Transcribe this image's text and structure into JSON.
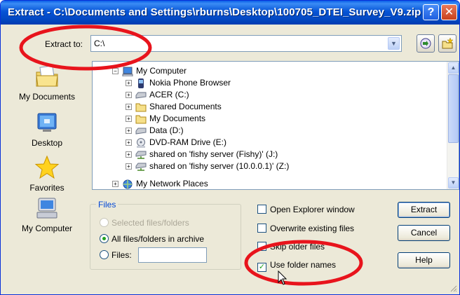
{
  "window": {
    "title": "Extract - C:\\Documents and Settings\\rburns\\Desktop\\100705_DTEI_Survey_V9.zip",
    "help_glyph": "?",
    "close_glyph": "✕"
  },
  "extract_to": {
    "label": "Extract to:",
    "value": "C:\\"
  },
  "places": [
    {
      "label": "My Documents",
      "icon": "my-documents-icon"
    },
    {
      "label": "Desktop",
      "icon": "desktop-icon"
    },
    {
      "label": "Favorites",
      "icon": "favorites-star-icon"
    },
    {
      "label": "My Computer",
      "icon": "my-computer-icon"
    }
  ],
  "tree": [
    {
      "label": "My Computer",
      "expander": "−",
      "icon": "my-computer-icon",
      "level": 0
    },
    {
      "label": "Nokia Phone Browser",
      "expander": "+",
      "icon": "phone-icon",
      "level": 1
    },
    {
      "label": "ACER (C:)",
      "expander": "+",
      "icon": "hard-drive-icon",
      "level": 1
    },
    {
      "label": "Shared Documents",
      "expander": "+",
      "icon": "folder-icon",
      "level": 1
    },
    {
      "label": "My Documents",
      "expander": "+",
      "icon": "folder-icon",
      "level": 1
    },
    {
      "label": "Data (D:)",
      "expander": "+",
      "icon": "hard-drive-icon",
      "level": 1
    },
    {
      "label": "DVD-RAM Drive (E:)",
      "expander": "+",
      "icon": "dvd-drive-icon",
      "level": 1
    },
    {
      "label": "shared on 'fishy server (Fishy)' (J:)",
      "expander": "+",
      "icon": "network-drive-icon",
      "level": 1
    },
    {
      "label": "shared on 'fishy server (10.0.0.1)' (Z:)",
      "expander": "+",
      "icon": "network-drive-icon",
      "level": 1
    },
    {
      "label": "My Network Places",
      "expander": "+",
      "icon": "network-places-icon",
      "level": 0
    }
  ],
  "files_group": {
    "legend": "Files",
    "options": [
      {
        "label": "Selected files/folders",
        "selected": false,
        "disabled": true
      },
      {
        "label": "All files/folders in archive",
        "selected": true,
        "disabled": false
      },
      {
        "label": "Files:",
        "selected": false,
        "disabled": false
      }
    ],
    "files_value": ""
  },
  "checkboxes": [
    {
      "label": "Open Explorer window",
      "checked": false
    },
    {
      "label": "Overwrite existing files",
      "checked": false
    },
    {
      "label": "Skip older files",
      "checked": false
    },
    {
      "label": "Use folder names",
      "checked": true
    }
  ],
  "buttons": {
    "extract": "Extract",
    "cancel": "Cancel",
    "help": "Help"
  },
  "colors": {
    "titlebar": "#0654d6",
    "dialog_bg": "#ece9d8",
    "annotation_red": "#e8141c",
    "group_legend": "#0046d5"
  }
}
